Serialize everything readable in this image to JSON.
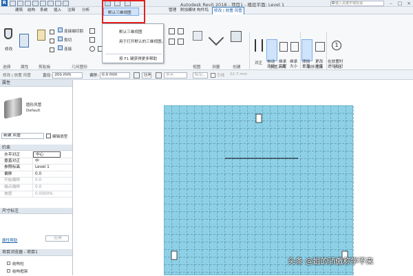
{
  "titlebar": {
    "title": "Autodesk Revit 2018 -   项目1 - 楼层平面: Level 1",
    "search_placeholder": "键入关键字或短语",
    "window_buttons": [
      "–",
      "□",
      "×"
    ]
  },
  "ribbon_tabs": [
    "建筑",
    "结构",
    "系统",
    "插入",
    "注释",
    "分析",
    "管理",
    "附加模块",
    "构件坞",
    "修改 | 放置 风管"
  ],
  "ribbon": {
    "modify_label": "修改",
    "panel_labels": [
      "选择",
      "属性",
      "剪贴板",
      "几何图形",
      "视图",
      "测量",
      "创建",
      "放置工具",
      "偏移连接",
      "标记"
    ],
    "geometry_small": [
      "连接端切割",
      "剪切",
      "连接"
    ],
    "placement_tools": [
      "对正",
      "自动连接",
      "继承高程",
      "继承大小"
    ],
    "offset_tools": [
      "添加垂直",
      "更改坡度"
    ],
    "tag_tool": "在放置时进行标记"
  },
  "dropdown": {
    "header": "默认三维视图",
    "title": "默认三维视图",
    "description": "用于打开默认的三维视图。",
    "help": "按 F1 键获得更多帮助"
  },
  "optionbar": {
    "context": "修改 | 放置 风管",
    "diameter_label": "直径:",
    "diameter_value": "305 mm",
    "offset_label": "偏移:",
    "offset_value": "0.0 mm",
    "apply": "应用",
    "horizontal": "水平",
    "markup": "标记...",
    "lead_label": "引线",
    "lead_value": "12.7 mm"
  },
  "properties": {
    "header": "属性",
    "type_name": "圆形风管",
    "type_sub": "Default",
    "new_item": "新建 风管",
    "edit_type": "编辑类型",
    "section_constraints": "约束",
    "rows": [
      {
        "key": "水平对正",
        "value": "中心"
      },
      {
        "key": "垂直对正",
        "value": "中"
      },
      {
        "key": "参照标高",
        "value": "Level 1"
      },
      {
        "key": "偏移",
        "value": "0.0"
      },
      {
        "key": "开始偏移",
        "value": "0.0"
      },
      {
        "key": "端点偏移",
        "value": "0.0"
      },
      {
        "key": "坡度",
        "value": "0.0000%"
      }
    ],
    "section_dims": "尺寸标注",
    "help_link": "属性帮助",
    "apply_button": "应用"
  },
  "project_browser": {
    "header": "项目浏览器 - 项目1",
    "items": [
      "结构柱",
      "结构框架"
    ]
  },
  "watermark": "头条 @姐的骄傲称学不来",
  "colors": {
    "plan_fill": "#8ed0e6",
    "grid_line": "#2c5f7a",
    "highlight": "#e02020",
    "tab_active": "#1b5fa7"
  }
}
